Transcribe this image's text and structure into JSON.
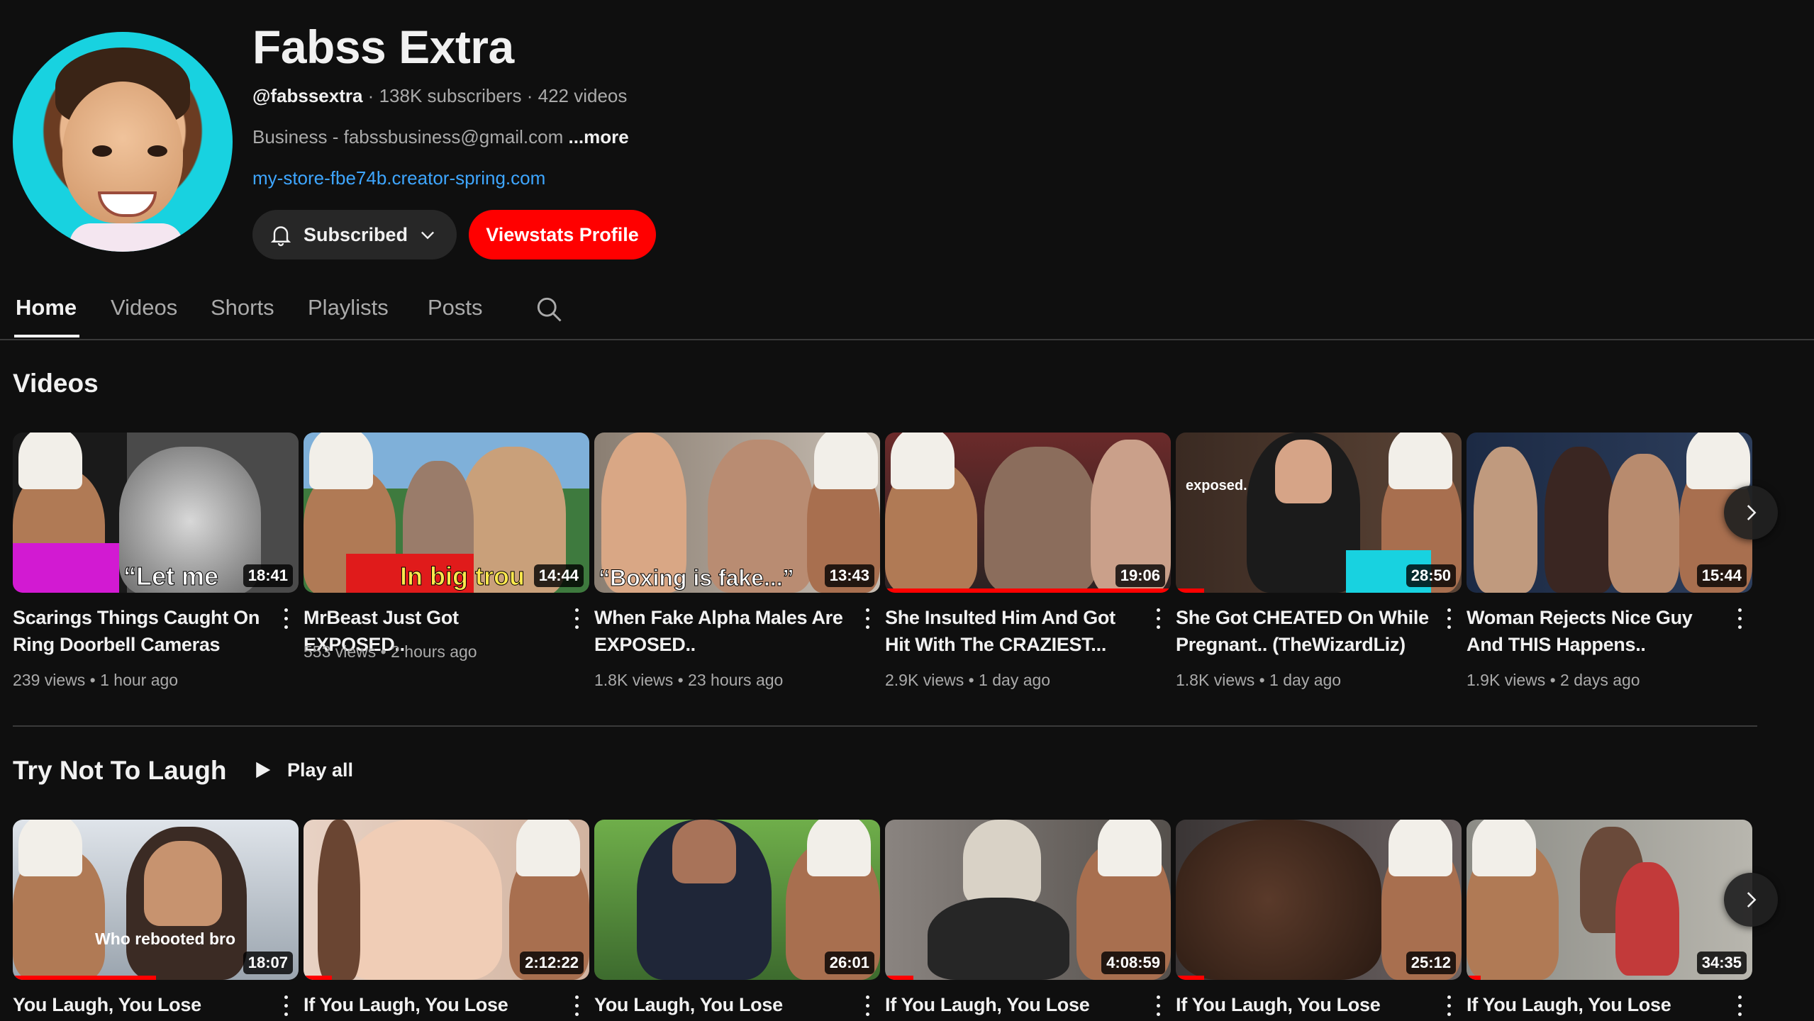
{
  "channel": {
    "title": "Fabss Extra",
    "handle": "@fabssextra",
    "subscribers": "138K subscribers",
    "videos_count": "422 videos",
    "separator": "·",
    "description": "Business - fabssbusiness@gmail.com",
    "more_label": "...more",
    "link": "my-store-fbe74b.creator-spring.com",
    "subscribed_label": "Subscribed",
    "viewstats_label": "Viewstats Profile",
    "accent_color": "#ff0000",
    "link_color": "#3ea6ff"
  },
  "tabs": [
    {
      "label": "Home",
      "active": true
    },
    {
      "label": "Videos",
      "active": false
    },
    {
      "label": "Shorts",
      "active": false
    },
    {
      "label": "Playlists",
      "active": false
    },
    {
      "label": "Posts",
      "active": false
    }
  ],
  "sections": [
    {
      "title": "Videos",
      "videos": [
        {
          "title": "Scarings Things Caught On Ring Doorbell Cameras",
          "meta": "239 views • 1 hour ago",
          "duration": "18:41",
          "overlay": "“Let me",
          "progress": 0
        },
        {
          "title": "MrBeast Just Got EXPOSED..",
          "meta": "553 views • 2 hours ago",
          "duration": "14:44",
          "overlay": "In big trou",
          "progress": 0
        },
        {
          "title": "When Fake Alpha Males Are EXPOSED..",
          "meta": "1.8K views • 23 hours ago",
          "duration": "13:43",
          "overlay": "“Boxing is fake...”",
          "progress": 0
        },
        {
          "title": "She Insulted Him And Got Hit With The CRAZIEST...",
          "meta": "2.9K views • 1 day ago",
          "duration": "19:06",
          "overlay": "",
          "progress": 1
        },
        {
          "title": "She Got CHEATED On While Pregnant.. (TheWizardLiz)",
          "meta": "1.8K views • 1 day ago",
          "duration": "28:50",
          "overlay": "exposed.",
          "progress": 0.1
        },
        {
          "title": "Woman Rejects Nice Guy And THIS Happens..",
          "meta": "1.9K views • 2 days ago",
          "duration": "15:44",
          "overlay": "",
          "progress": 0
        }
      ]
    },
    {
      "title": "Try Not To Laugh",
      "play_all_label": "Play all",
      "videos": [
        {
          "title": "You Laugh, You Lose",
          "duration": "18:07",
          "overlay": "Who rebooted bro",
          "progress": 0.5
        },
        {
          "title": "If You Laugh, You Lose",
          "duration": "2:12:22",
          "overlay": "",
          "progress": 0.1
        },
        {
          "title": "You Laugh, You Lose",
          "duration": "26:01",
          "overlay": "",
          "progress": 0
        },
        {
          "title": "If You Laugh, You Lose",
          "duration": "4:08:59",
          "overlay": "",
          "progress": 0.1
        },
        {
          "title": "If You Laugh, You Lose",
          "duration": "25:12",
          "overlay": "",
          "progress": 0.1
        },
        {
          "title": "If You Laugh, You Lose",
          "duration": "34:35",
          "overlay": "",
          "progress": 0.05
        }
      ]
    }
  ],
  "icons": {
    "bell": "bell-icon",
    "chevron": "chevron-down-icon",
    "search": "search-icon",
    "next": "chevron-right-icon",
    "play": "play-icon",
    "more": "more-vertical-icon"
  }
}
